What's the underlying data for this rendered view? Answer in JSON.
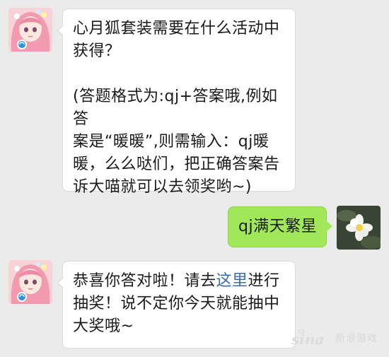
{
  "messages": [
    {
      "from": "them",
      "avatar_icon": "anime-girl-avatar-icon",
      "question_lines": [
        "心月狐套装需要在什么活动中",
        "获得？"
      ],
      "hint_lines": [
        "(答题格式为:qj+答案哦,例如答",
        "案是“暖暖”,则需输入：qj暖",
        "暖，么么哒们，把正确答案告",
        "诉大喵就可以去领奖哟~)"
      ]
    },
    {
      "from": "me",
      "avatar_icon": "white-flower-avatar-icon",
      "text": "qj满天繁星"
    },
    {
      "from": "them",
      "avatar_icon": "anime-girl-avatar-icon",
      "line1_before": "恭喜你答对啦！请去",
      "line1_link": "这里",
      "line1_after": "进行",
      "line2": "抽奖！说不定你今天就能抽中",
      "line3": "大奖哦~"
    }
  ],
  "watermark": {
    "logo_text": "sina",
    "name": "新浪游戏"
  },
  "colors": {
    "background": "#ebebeb",
    "incoming_bubble": "#ffffff",
    "outgoing_bubble": "#a0e75a",
    "link": "#3a6ca8"
  }
}
